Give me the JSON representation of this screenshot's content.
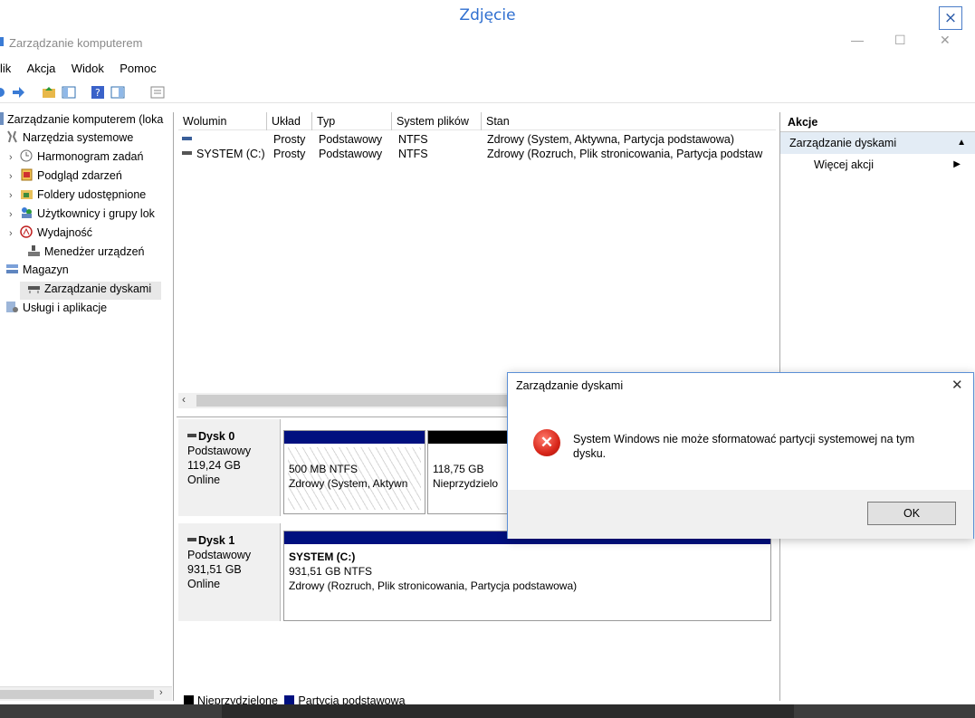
{
  "viewer": {
    "title": "Zdjęcie",
    "close_glyph": "×"
  },
  "window": {
    "title": "Zarządzanie komputerem",
    "minimize_glyph": "—",
    "maximize_glyph": "☐",
    "close_glyph": "✕"
  },
  "menu": [
    "lik",
    "Akcja",
    "Widok",
    "Pomoc"
  ],
  "tree": {
    "root": "Zarządzanie komputerem (loka",
    "system_tools": "Narzędzia systemowe",
    "task_scheduler": "Harmonogram zadań",
    "event_viewer": "Podgląd zdarzeń",
    "shared_folders": "Foldery udostępnione",
    "users_groups": "Użytkownicy i grupy lok",
    "performance": "Wydajność",
    "device_manager": "Menedżer urządzeń",
    "storage": "Magazyn",
    "disk_management": "Zarządzanie dyskami",
    "services": "Usługi i aplikacje"
  },
  "volume_list": {
    "columns": [
      "Wolumin",
      "Układ",
      "Typ",
      "System plików",
      "Stan"
    ],
    "rows": [
      {
        "volume": "",
        "layout": "Prosty",
        "type": "Podstawowy",
        "fs": "NTFS",
        "status": "Zdrowy (System, Aktywna, Partycja podstawowa)"
      },
      {
        "volume": "SYSTEM (C:)",
        "layout": "Prosty",
        "type": "Podstawowy",
        "fs": "NTFS",
        "status": "Zdrowy (Rozruch, Plik stronicowania, Partycja podstaw"
      }
    ]
  },
  "disks": [
    {
      "name": "Dysk 0",
      "kind": "Podstawowy",
      "size": "119,24 GB",
      "state": "Online",
      "partitions": [
        {
          "line1": "500 MB NTFS",
          "line2": "Zdrowy (System, Aktywn"
        },
        {
          "line1": "118,75 GB",
          "line2": "Nieprzydzielo"
        }
      ]
    },
    {
      "name": "Dysk 1",
      "kind": "Podstawowy",
      "size": "931,51 GB",
      "state": "Online",
      "partitions": [
        {
          "title": "SYSTEM  (C:)",
          "line1": "931,51 GB NTFS",
          "line2": "Zdrowy (Rozruch, Plik stronicowania, Partycja podstawowa)"
        }
      ]
    }
  ],
  "legend": {
    "unallocated": "Nieprzydzielone",
    "primary": "Partycja podstawowa"
  },
  "actions": {
    "header": "Akcje",
    "group": "Zarządzanie dyskami",
    "more": "Więcej akcji"
  },
  "dialog": {
    "title": "Zarządzanie dyskami",
    "icon_glyph": "✕",
    "message": "System Windows nie może sformatować partycji systemowej na tym dysku.",
    "ok": "OK",
    "close_glyph": "✕"
  },
  "colors": {
    "primary_partition": "#00107f",
    "unallocated": "#000000",
    "viewer_accent": "#2f6fd0",
    "error_red": "#d8261a"
  }
}
